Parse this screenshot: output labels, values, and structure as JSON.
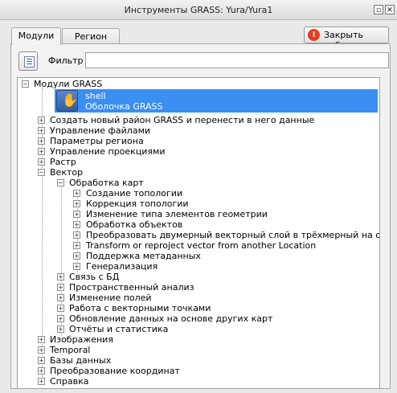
{
  "window": {
    "title": "Инструменты GRASS: Yura/Yura1"
  },
  "tabs": {
    "modules": "Модули",
    "region": "Регион"
  },
  "close_set": {
    "label": "Закрыть набор"
  },
  "filter": {
    "label": "Фильтр",
    "value": ""
  },
  "tree": {
    "root": "Модули GRASS",
    "shell_name": "shell",
    "shell_desc": "Оболочка GRASS",
    "l1": [
      "Создать новый район GRASS и перенести в него данные",
      "Управление файлами",
      "Параметры региона",
      "Управление проекциями",
      "Растр",
      "Вектор"
    ],
    "vector_children": [
      "Обработка карт",
      "Связь с БД",
      "Пространственный анализ",
      "Изменение полей",
      "Работа с векторными точками",
      "Обновление данных на основе других карт",
      "Отчёты и статистика"
    ],
    "map_processing": [
      "Создание топологии",
      "Коррекция топологии",
      "Изменение типа элементов геометрии",
      "Обработка объектов",
      "Преобразовать двумерный векторный слой в трёхмерный на основе...",
      "Transform or reproject vector from another Location",
      "Поддержка метаданных",
      "Генерализация"
    ],
    "l1_after": [
      "Изображения",
      "Temporal",
      "Базы данных",
      "Преобразование координат",
      "Справка"
    ]
  },
  "icons": {
    "close": "close-icon",
    "float": "float-icon",
    "filter": "filter-icon",
    "stop": "stop-icon",
    "shell": "shell-icon"
  }
}
